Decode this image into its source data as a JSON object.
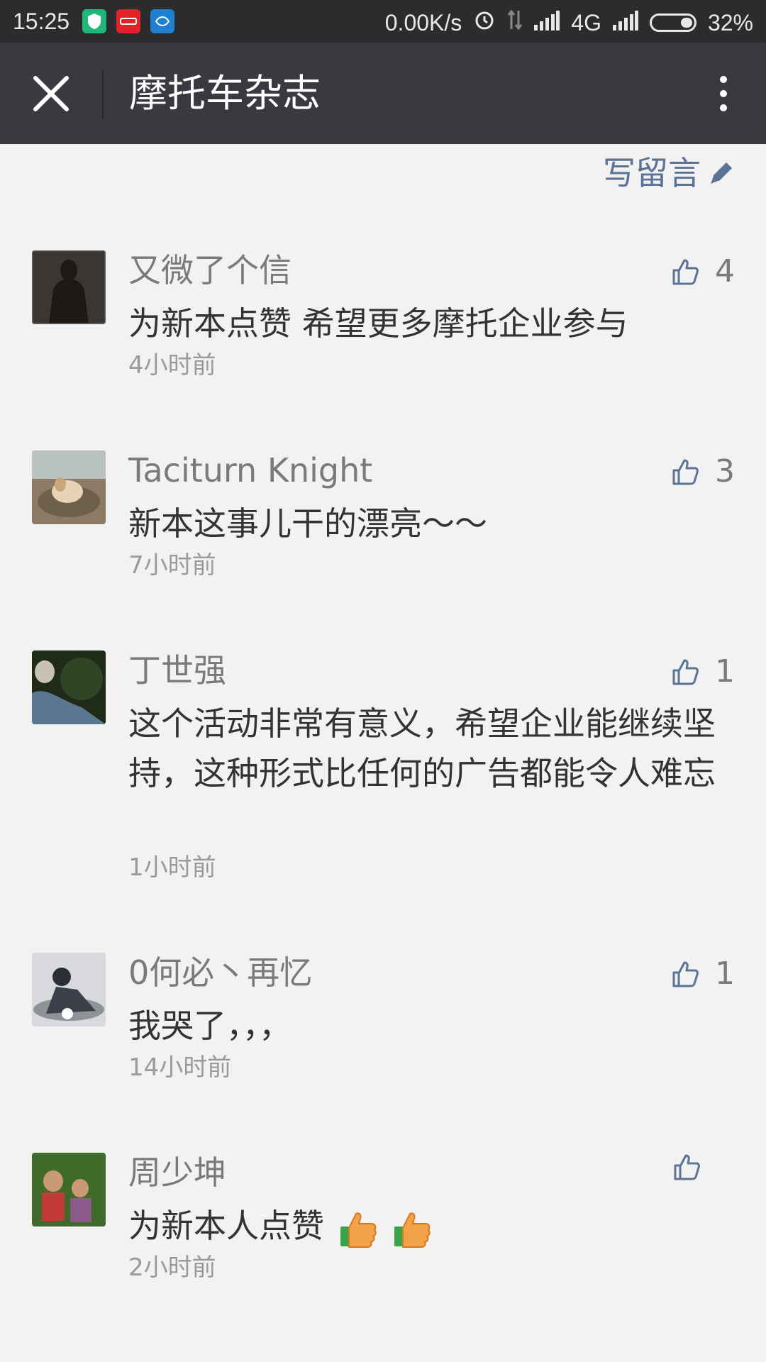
{
  "status_bar": {
    "time": "15:25",
    "net_speed": "0.00K/s",
    "network": "4G",
    "battery": "32%",
    "icons": [
      "shield-app-icon",
      "red-app-icon",
      "blue-app-icon",
      "alarm-icon",
      "data-arrows-icon",
      "signal-icon",
      "signal-icon-2",
      "battery-icon"
    ]
  },
  "header": {
    "title": "摩托车杂志",
    "close_icon": "close-icon",
    "more_icon": "more-vertical-icon"
  },
  "write_comment": {
    "label": "写留言",
    "icon": "pencil-icon",
    "color": "#5b7495"
  },
  "comments": [
    {
      "name": "又微了个信",
      "text": "为新本点赞  希望更多摩托企业参与",
      "time": "4小时前",
      "likes": "4"
    },
    {
      "name": "Taciturn Knight",
      "text": "新本这事儿干的漂亮～～",
      "time": "7小时前",
      "likes": "3"
    },
    {
      "name": "丁世强",
      "text": "这个活动非常有意义，希望企业能继续坚持，这种形式比任何的广告都能令人难忘",
      "time": "1小时前",
      "likes": "1"
    },
    {
      "name": "0何必丶再忆",
      "text": "我哭了，，，",
      "time": "14小时前",
      "likes": "1"
    },
    {
      "name": "周少坤",
      "text": "为新本人点赞",
      "time": "2小时前",
      "likes": ""
    }
  ],
  "colors": {
    "status_bar_bg": "#2c2c2e",
    "title_bar_bg": "#393a3f",
    "page_bg": "#f2f2f2",
    "link_blue": "#5b7495"
  }
}
